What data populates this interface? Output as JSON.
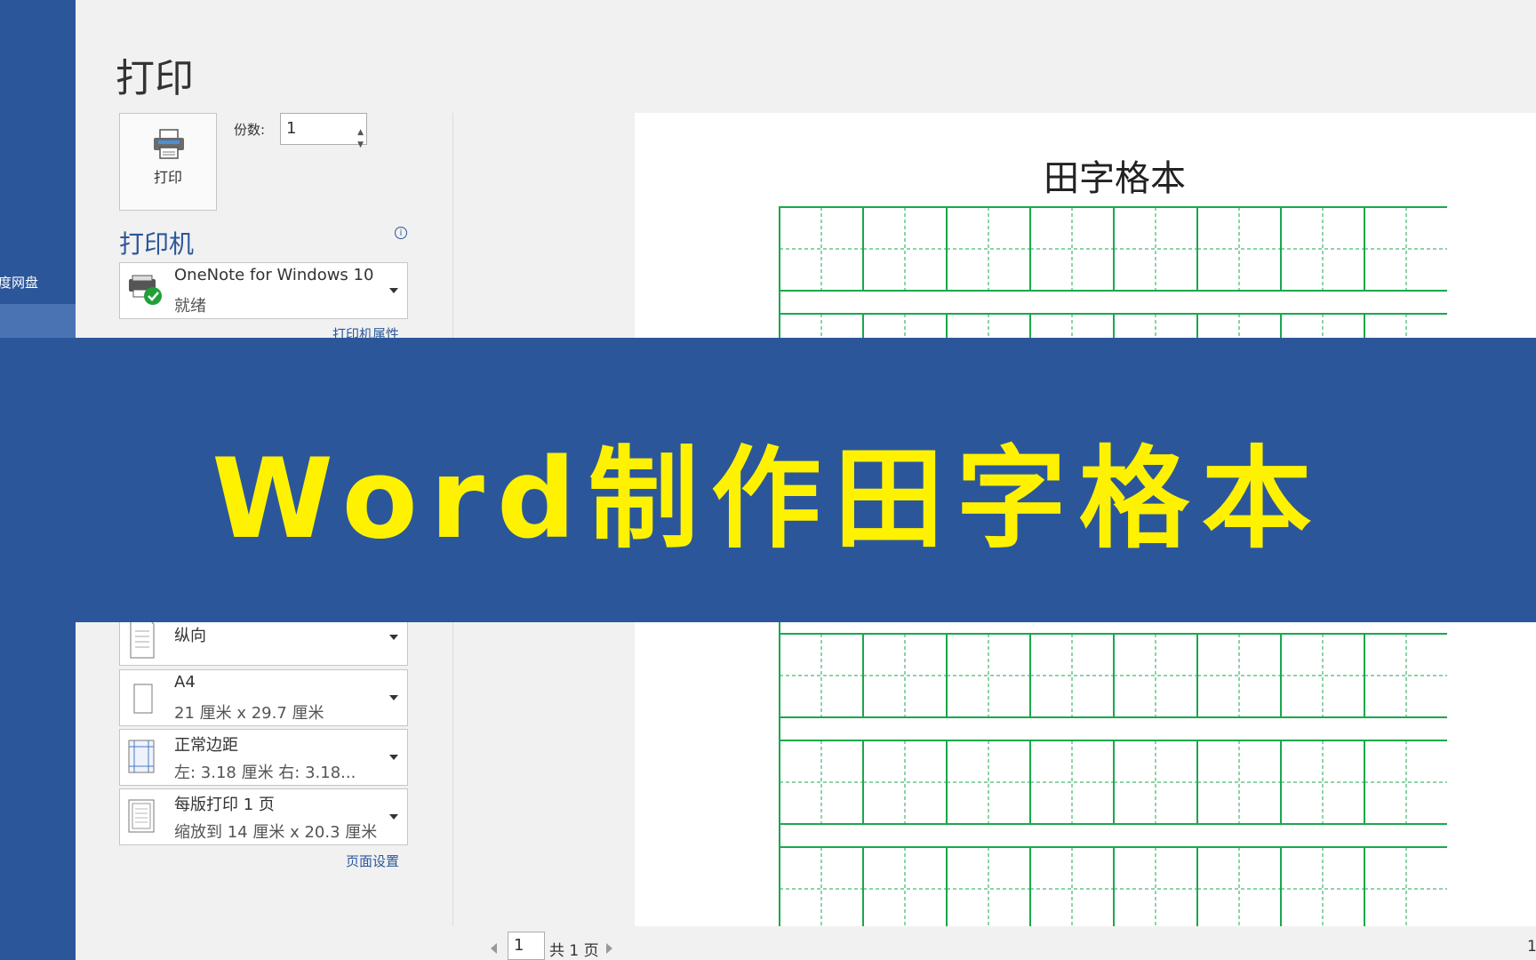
{
  "sidebar": {
    "items": [
      {
        "label": "度网盘"
      }
    ]
  },
  "print": {
    "title": "打印",
    "button_label": "打印",
    "copies_label": "份数:",
    "copies_value": "1"
  },
  "printer": {
    "heading": "打印机",
    "name": "OneNote for Windows 10",
    "status": "就绪",
    "properties_link": "打印机属性"
  },
  "settings": [
    {
      "main": "纵向",
      "sub": "",
      "icon": "portrait-page-icon"
    },
    {
      "main": "A4",
      "sub": "21 厘米 x 29.7 厘米",
      "icon": "paper-size-icon"
    },
    {
      "main": "正常边距",
      "sub": "左:  3.18 厘米     右:  3.18...",
      "icon": "margins-icon"
    },
    {
      "main": "每版打印 1 页",
      "sub": "缩放到 14 厘米 x 20.3 厘米",
      "icon": "pages-per-sheet-icon"
    }
  ],
  "page_setup_link": "页面设置",
  "preview": {
    "doc_title": "田字格本",
    "grid_color": "#1aa84c"
  },
  "banner": {
    "title": "Word制作田字格本",
    "bg_color": "#2b579a",
    "text_color": "#fff200"
  },
  "pager": {
    "current": "1",
    "total": "共 1 页",
    "zoom": "1"
  }
}
